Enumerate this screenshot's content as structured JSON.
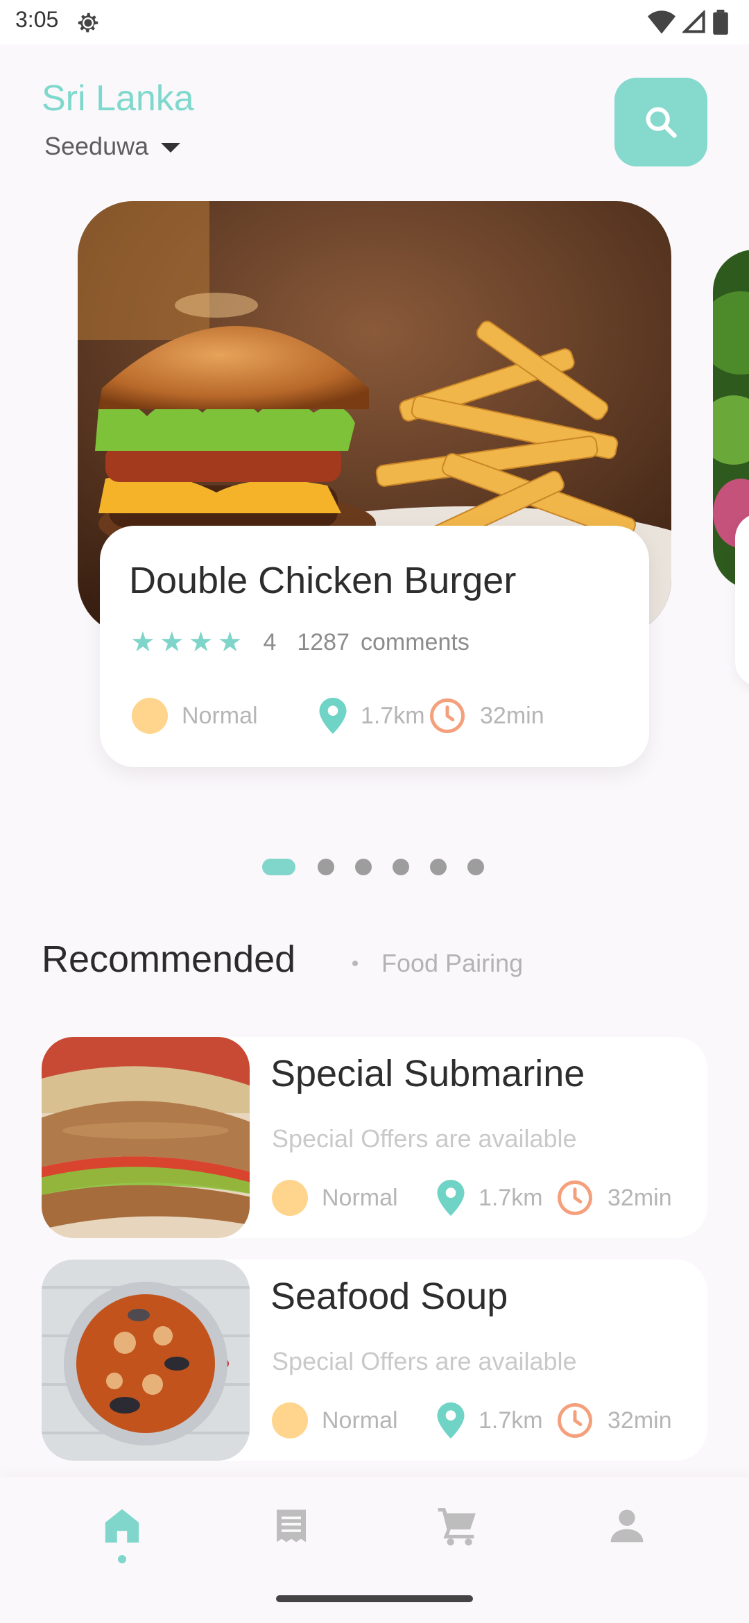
{
  "status_bar": {
    "time": "3:05"
  },
  "header": {
    "country": "Sri Lanka",
    "city": "Seeduwa"
  },
  "hero": {
    "title": "Double Chicken Burger",
    "rating": "4",
    "comments_count": "1287",
    "comments_label": "comments",
    "level": "Normal",
    "distance": "1.7km",
    "time": "32min"
  },
  "pager": {
    "count": 6,
    "active_index": 0
  },
  "recommended": {
    "title": "Recommended",
    "subtitle": "Food Pairing",
    "items": [
      {
        "title": "Special Submarine",
        "subtitle": "Special Offers are available",
        "level": "Normal",
        "distance": "1.7km",
        "time": "32min"
      },
      {
        "title": "Seafood Soup",
        "subtitle": "Special Offers are available",
        "level": "Normal",
        "distance": "1.7km",
        "time": "32min"
      }
    ]
  },
  "bottom_nav": {
    "items": [
      "home-icon",
      "receipt-icon",
      "cart-icon",
      "profile-icon"
    ],
    "active": "home-icon"
  },
  "colors": {
    "accent": "#80d6cb",
    "level_dot": "#ffd58e",
    "distance_icon": "#6fd3c6",
    "time_icon": "#f5a07c"
  }
}
